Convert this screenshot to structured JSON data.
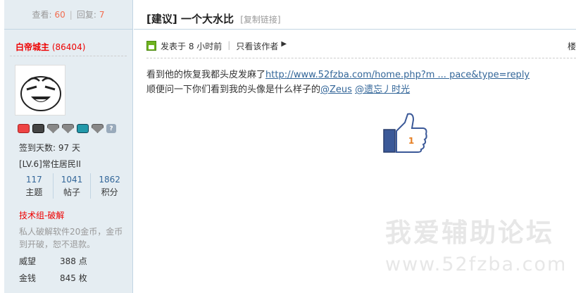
{
  "sidebar": {
    "views_label": "查看:",
    "views": "60",
    "separator": "|",
    "replies_label": "回复:",
    "replies": "7",
    "author_name": "白帝城主",
    "author_uid": "(86404)",
    "medals": [
      "medal-red-icon",
      "medal-dark-icon",
      "medal-gray-icon",
      "medal-gray-icon",
      "medal-blue-icon",
      "medal-gray-icon",
      "medal-question-icon"
    ],
    "signin_days": "签到天数: 97 天",
    "level": "[LV.6]常住居民II",
    "stats": [
      {
        "value": "117",
        "label": "主题"
      },
      {
        "value": "1041",
        "label": "帖子"
      },
      {
        "value": "1862",
        "label": "积分"
      }
    ],
    "group": "技术组-破解",
    "signature": "私人破解软件20金币，金币到开破，恕不退款。",
    "fields": [
      {
        "key": "威望",
        "value": "388 点"
      },
      {
        "key": "金钱",
        "value": "845 枚"
      }
    ]
  },
  "post": {
    "tag": "[建议]",
    "title": "一个大水比",
    "copy_link": "[复制链接]",
    "posted": "发表于 8 小时前",
    "author_only": "只看该作者",
    "floor": "楼",
    "line1_text": "看到他的恢复我都头皮发麻了",
    "line1_link": "http://www.52fzba.com/home.php?m ... pace&type=reply",
    "line2_text": "顺便问一下你们看到我的头像是什么样子的",
    "mention1": "@Zeus",
    "mention2": "@遗忘丿时光",
    "thumb_number": "1"
  },
  "watermark": {
    "line1": "我爱辅助论坛",
    "line2": "www.52fzba.com"
  },
  "colors": {
    "sidebar_bg": "#e5edf2",
    "border": "#c2d5e3",
    "link": "#336699",
    "author": "#ee0000",
    "count_accent": "#f26c4f"
  }
}
